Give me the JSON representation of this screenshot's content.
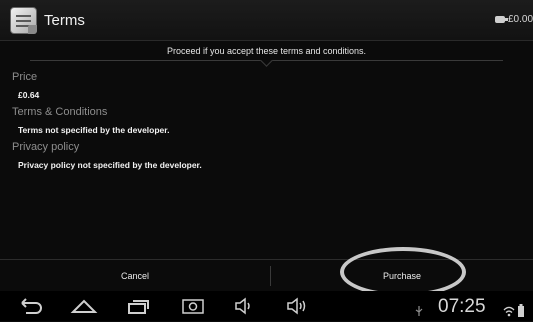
{
  "titlebar": {
    "title": "Terms",
    "balance": "£0.00",
    "app_icon": "store-app-icon",
    "wallet_icon": "wallet-icon"
  },
  "notice": "Proceed if you accept these terms and conditions.",
  "sections": {
    "price": {
      "heading": "Price",
      "value": "£0.64"
    },
    "terms": {
      "heading": "Terms & Conditions",
      "value": "Terms not specified by the developer."
    },
    "privacy": {
      "heading": "Privacy policy",
      "value": "Privacy policy not specified by the developer."
    }
  },
  "actions": {
    "cancel_label": "Cancel",
    "purchase_label": "Purchase"
  },
  "navbar": {
    "icons": [
      "back-icon",
      "home-icon",
      "recent-apps-icon",
      "screenshot-icon",
      "volume-down-icon",
      "volume-up-icon"
    ],
    "status_icons": [
      "usb-icon",
      "wifi-icon",
      "battery-icon"
    ],
    "time": "07:25"
  },
  "colors": {
    "background": "#0b0b0b",
    "heading": "#8d8d8d",
    "text": "#f2f2f2",
    "highlight_circle": "#c8c8c8"
  }
}
